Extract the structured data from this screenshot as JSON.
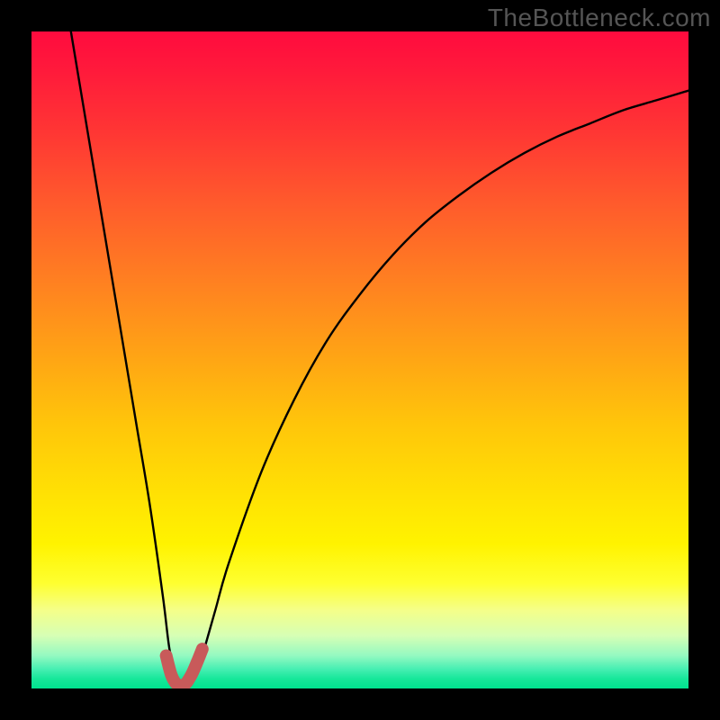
{
  "watermark": "TheBottleneck.com",
  "chart_data": {
    "type": "line",
    "title": "",
    "xlabel": "",
    "ylabel": "",
    "xlim": [
      0,
      100
    ],
    "ylim": [
      0,
      100
    ],
    "series": [
      {
        "name": "bottleneck-curve",
        "x": [
          6,
          8,
          10,
          12,
          14,
          16,
          18,
          20,
          21,
          22,
          23,
          24,
          25,
          26,
          28,
          30,
          35,
          40,
          45,
          50,
          55,
          60,
          65,
          70,
          75,
          80,
          85,
          90,
          95,
          100
        ],
        "y": [
          100,
          88,
          76,
          64,
          52,
          40,
          28,
          14,
          6,
          2,
          0.5,
          0.5,
          2,
          5,
          12,
          19,
          33,
          44,
          53,
          60,
          66,
          71,
          75,
          78.5,
          81.5,
          84,
          86,
          88,
          89.5,
          91
        ]
      }
    ],
    "highlight": {
      "name": "optimal-region",
      "color": "#c85a5a",
      "x": [
        20.5,
        21.3,
        22.2,
        23.3,
        24.3,
        25.2,
        26.0
      ],
      "y": [
        5,
        2,
        0.6,
        0.6,
        2,
        4,
        6
      ]
    },
    "gradient_stops": [
      {
        "pos": 0,
        "color": "#ff0b3e"
      },
      {
        "pos": 50,
        "color": "#ffa614"
      },
      {
        "pos": 80,
        "color": "#feff30"
      },
      {
        "pos": 100,
        "color": "#00e38e"
      }
    ]
  }
}
